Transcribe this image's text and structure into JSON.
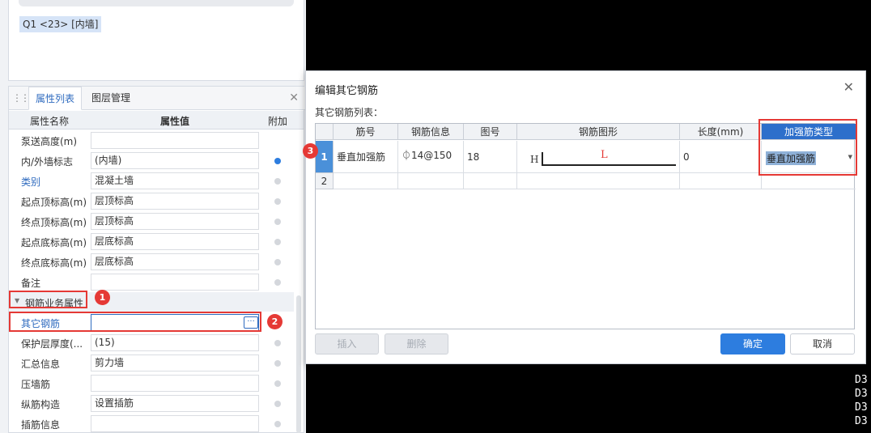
{
  "top_panel": {
    "chip": "Q1 <23> [内墙]"
  },
  "tabs": {
    "attr_list": "属性列表",
    "layer_manage": "图层管理"
  },
  "prop_header": {
    "name": "属性名称",
    "value": "属性值",
    "extra": "附加"
  },
  "rows_a": [
    {
      "label": "泵送高度(m)",
      "value": "",
      "dot": false,
      "blue": false,
      "show_dot": false
    },
    {
      "label": "内/外墙标志",
      "value": "(内墙)",
      "dot": true,
      "blue": false,
      "show_dot": true
    },
    {
      "label": "类别",
      "value": "混凝土墙",
      "dot": false,
      "blue": true,
      "show_dot": true
    },
    {
      "label": "起点顶标高(m)",
      "value": "层顶标高",
      "dot": false,
      "blue": false,
      "show_dot": true
    },
    {
      "label": "终点顶标高(m)",
      "value": "层顶标高",
      "dot": false,
      "blue": false,
      "show_dot": true
    },
    {
      "label": "起点底标高(m)",
      "value": "层底标高",
      "dot": false,
      "blue": false,
      "show_dot": true
    },
    {
      "label": "终点底标高(m)",
      "value": "层底标高",
      "dot": false,
      "blue": false,
      "show_dot": true
    },
    {
      "label": "备注",
      "value": "",
      "dot": false,
      "blue": false,
      "show_dot": true
    }
  ],
  "group": {
    "label": "钢筋业务属性"
  },
  "rows_b": [
    {
      "label": "其它钢筋",
      "value": "",
      "blue": true
    },
    {
      "label": "保护层厚度(...",
      "value": "(15)",
      "blue": false
    },
    {
      "label": "汇总信息",
      "value": "剪力墙",
      "blue": false
    },
    {
      "label": "压墙筋",
      "value": "",
      "blue": false
    },
    {
      "label": "纵筋构造",
      "value": "设置插筋",
      "blue": false
    },
    {
      "label": "插筋信息",
      "value": "",
      "blue": false
    }
  ],
  "badges": {
    "b1": "1",
    "b2": "2",
    "b3": "3"
  },
  "cad": {
    "right_labels": [
      "D3",
      "D3",
      "D3",
      "D3"
    ]
  },
  "dialog": {
    "title": "编辑其它钢筋",
    "list_label": "其它钢筋列表：",
    "headers": {
      "bar_no": "筋号",
      "bar_info": "钢筋信息",
      "fig_no": "图号",
      "bar_shape": "钢筋图形",
      "length": "长度(mm)",
      "reinf_type": "加强筋类型"
    },
    "row1": {
      "num": "1",
      "bar_no": "垂直加强筋",
      "bar_info": "⏀14@150",
      "fig_no": "18",
      "shape_h": "H",
      "shape_l": "L",
      "length": "0",
      "reinf_type": "垂直加强筋"
    },
    "row2": {
      "num": "2"
    },
    "buttons": {
      "insert": "插入",
      "delete": "删除",
      "ok": "确定",
      "cancel": "取消"
    }
  }
}
